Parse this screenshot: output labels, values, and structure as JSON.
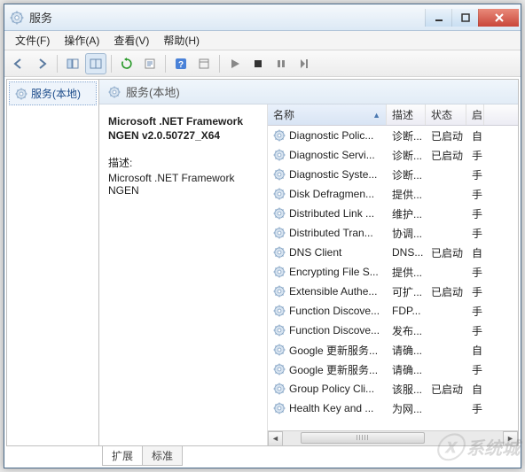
{
  "window": {
    "title": "服务"
  },
  "menu": {
    "file": "文件(F)",
    "action": "操作(A)",
    "view": "查看(V)",
    "help": "帮助(H)"
  },
  "left": {
    "root": "服务(本地)"
  },
  "right_header": "服务(本地)",
  "detail": {
    "name": "Microsoft .NET Framework NGEN v2.0.50727_X64",
    "desc_label": "描述:",
    "desc": "Microsoft .NET Framework NGEN"
  },
  "columns": {
    "name": "名称",
    "desc": "描述",
    "status": "状态",
    "startup": "启"
  },
  "col_widths": {
    "name": 134,
    "desc": 44,
    "status": 46,
    "startup": 20
  },
  "services": [
    {
      "name": "Diagnostic Polic...",
      "desc": "诊断...",
      "status": "已启动",
      "startup": "自"
    },
    {
      "name": "Diagnostic Servi...",
      "desc": "诊断...",
      "status": "已启动",
      "startup": "手"
    },
    {
      "name": "Diagnostic Syste...",
      "desc": "诊断...",
      "status": "",
      "startup": "手"
    },
    {
      "name": "Disk Defragmen...",
      "desc": "提供...",
      "status": "",
      "startup": "手"
    },
    {
      "name": "Distributed Link ...",
      "desc": "维护...",
      "status": "",
      "startup": "手"
    },
    {
      "name": "Distributed Tran...",
      "desc": "协调...",
      "status": "",
      "startup": "手"
    },
    {
      "name": "DNS Client",
      "desc": "DNS...",
      "status": "已启动",
      "startup": "自"
    },
    {
      "name": "Encrypting File S...",
      "desc": "提供...",
      "status": "",
      "startup": "手"
    },
    {
      "name": "Extensible Authe...",
      "desc": "可扩...",
      "status": "已启动",
      "startup": "手"
    },
    {
      "name": "Function Discove...",
      "desc": "FDP...",
      "status": "",
      "startup": "手"
    },
    {
      "name": "Function Discove...",
      "desc": "发布...",
      "status": "",
      "startup": "手"
    },
    {
      "name": "Google 更新服务...",
      "desc": "请确...",
      "status": "",
      "startup": "自"
    },
    {
      "name": "Google 更新服务...",
      "desc": "请确...",
      "status": "",
      "startup": "手"
    },
    {
      "name": "Group Policy Cli...",
      "desc": "该服...",
      "status": "已启动",
      "startup": "自"
    },
    {
      "name": "Health Key and ...",
      "desc": "为网...",
      "status": "",
      "startup": "手"
    }
  ],
  "tabs": {
    "extended": "扩展",
    "standard": "标准"
  },
  "watermark": "系统城"
}
